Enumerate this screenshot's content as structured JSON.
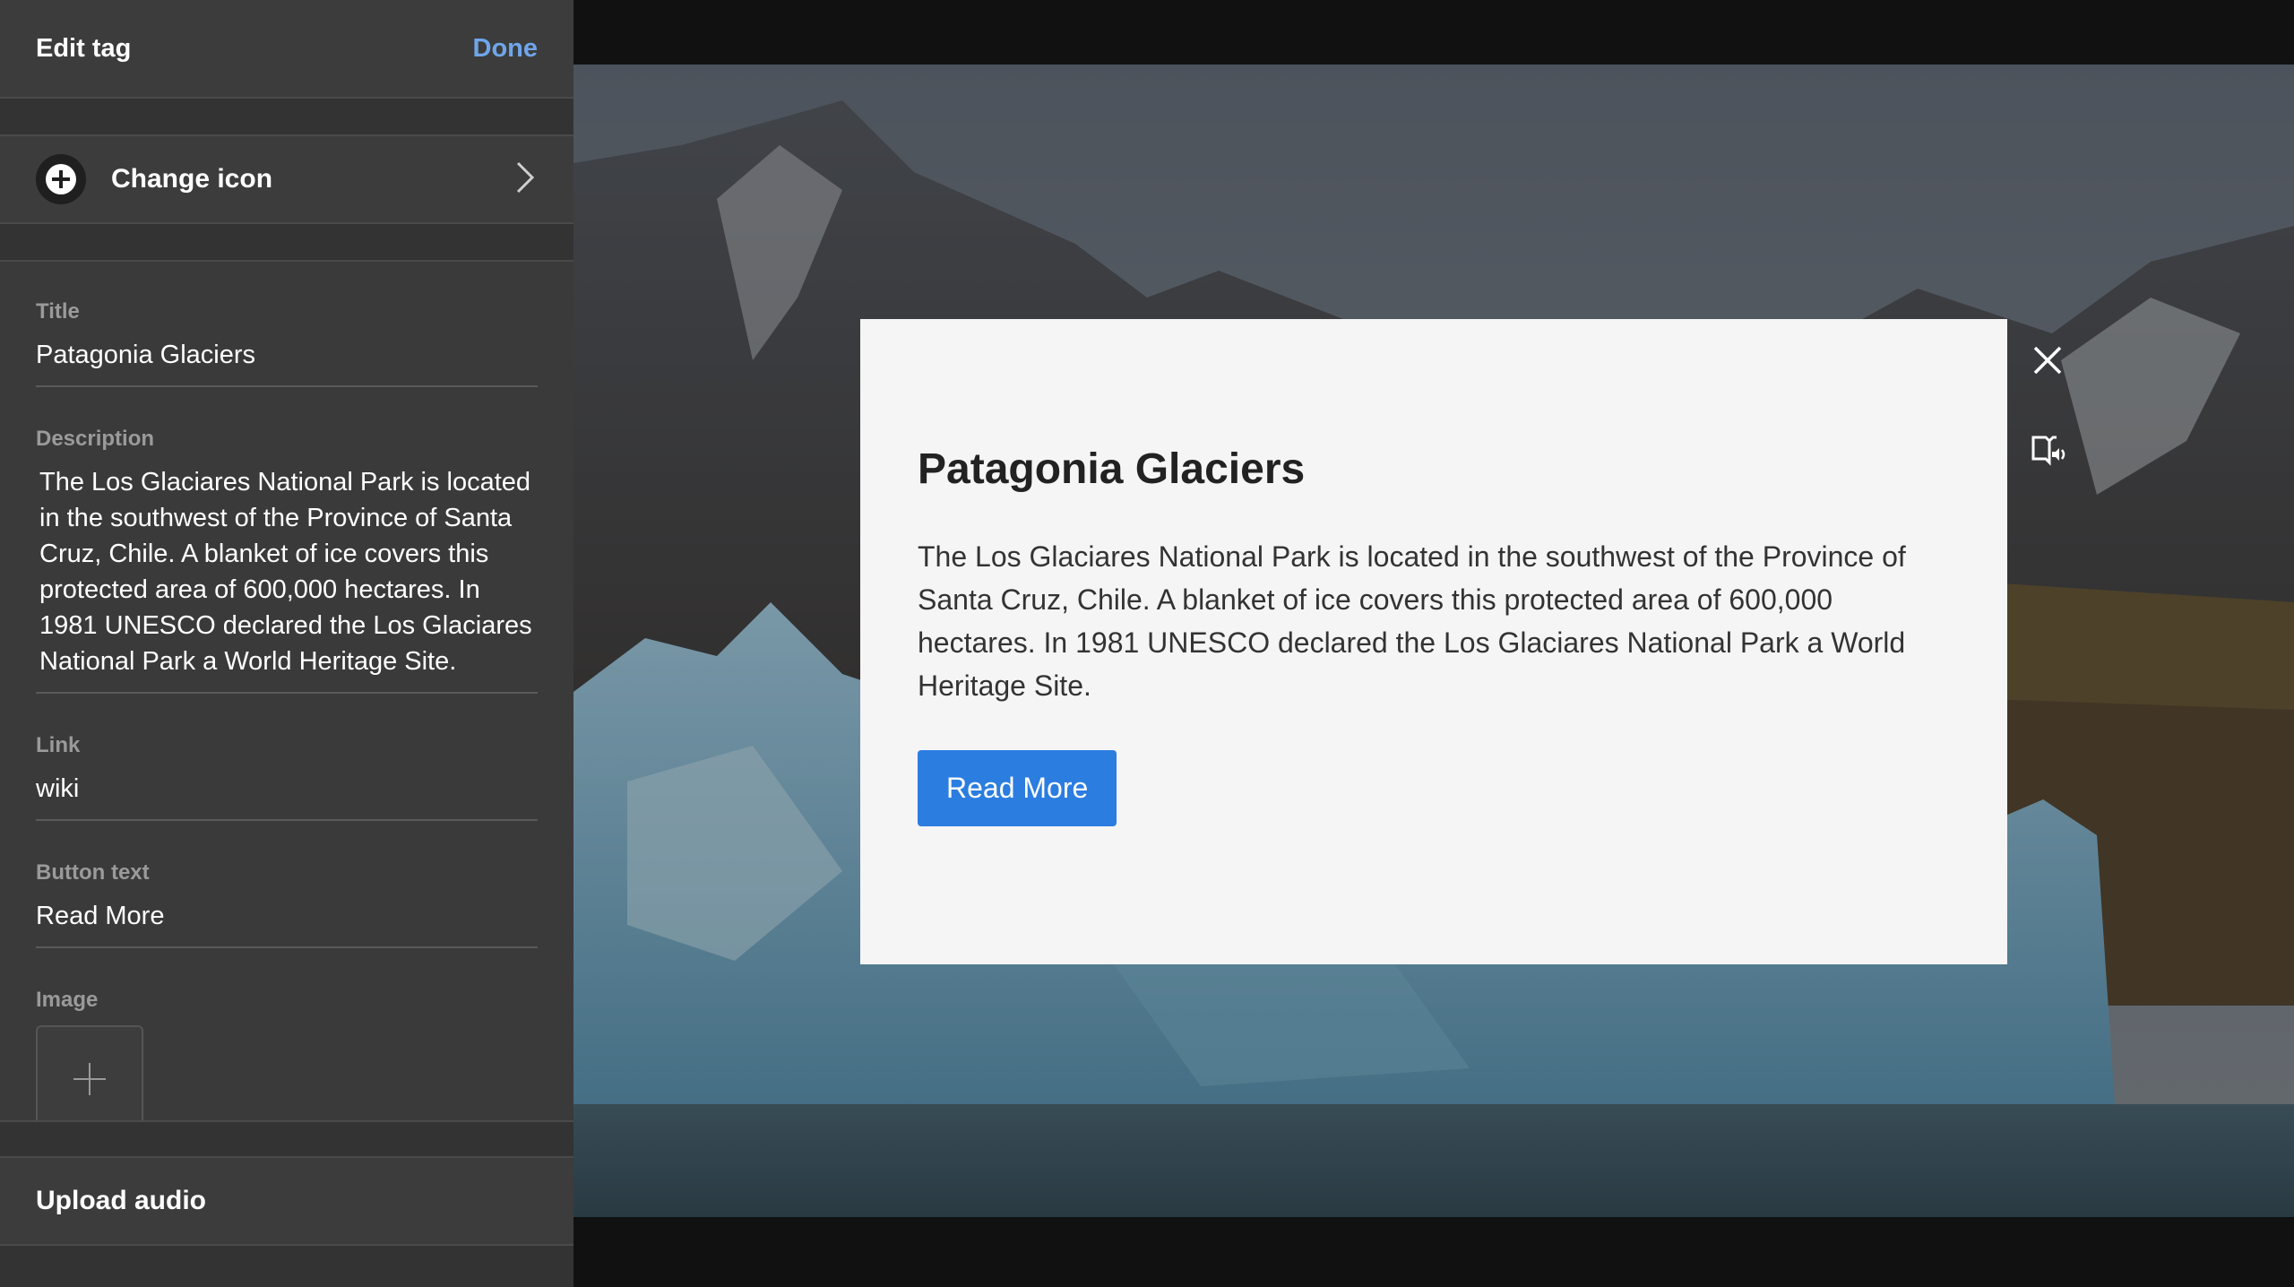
{
  "sidebar": {
    "header": {
      "title": "Edit tag",
      "done_label": "Done"
    },
    "change_icon_label": "Change icon",
    "fields": {
      "title": {
        "label": "Title",
        "value": "Patagonia Glaciers"
      },
      "description": {
        "label": "Description",
        "value": "The Los Glaciares National Park is located in the southwest of the Province of Santa Cruz, Chile. A blanket of ice covers this protected area of 600,000 hectares. In 1981 UNESCO declared the Los Glaciares National Park a World Heritage Site."
      },
      "link": {
        "label": "Link",
        "value": "wiki"
      },
      "button_text": {
        "label": "Button text",
        "value": "Read More"
      },
      "image": {
        "label": "Image"
      }
    },
    "upload_audio_label": "Upload audio"
  },
  "modal": {
    "title": "Patagonia Glaciers",
    "description": "The Los Glaciares National Park is located in the southwest of the Province of Santa Cruz, Chile. A blanket of ice covers this protected area of 600,000 hectares. In 1981 UNESCO declared the Los Glaciares National Park a World Heritage Site.",
    "button_label": "Read More"
  },
  "icons": {
    "change_icon": "plus-circle-icon",
    "chevron": "chevron-right-icon",
    "image_add": "plus-icon",
    "close": "close-icon",
    "audio": "audio-book-icon"
  },
  "colors": {
    "accent": "#2b7de0",
    "done_link": "#6fa6ea",
    "sidebar_bg": "#3a3a3a",
    "modal_bg": "#f5f5f5"
  }
}
